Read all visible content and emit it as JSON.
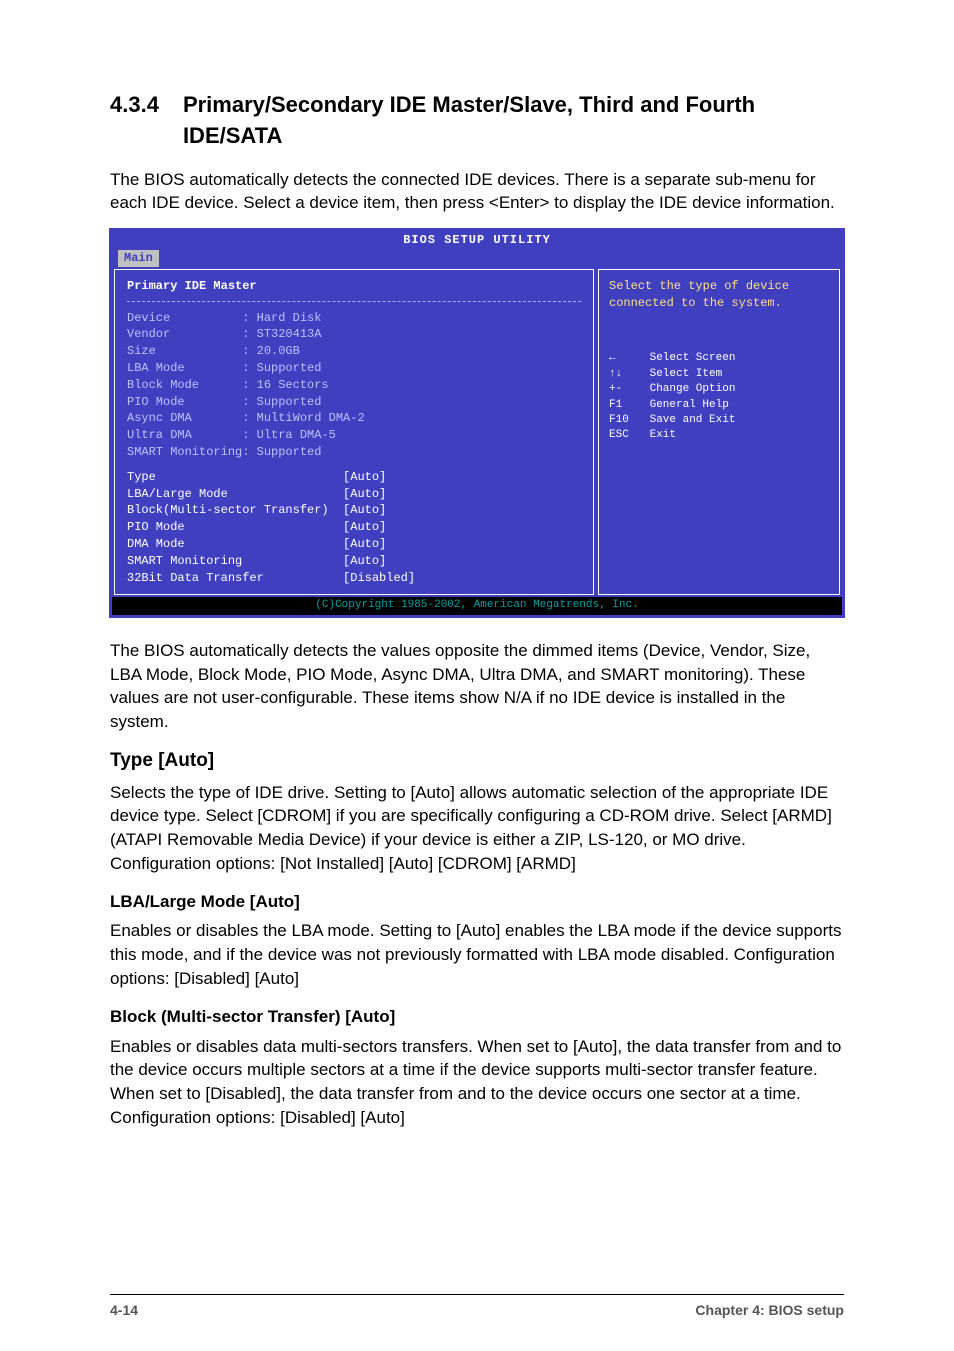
{
  "section": {
    "number": "4.3.4",
    "title": "Primary/Secondary IDE Master/Slave, Third and Fourth IDE/SATA"
  },
  "intro": "The BIOS automatically detects the connected IDE devices. There is a separate sub-menu for each IDE device. Select a device item, then press <Enter> to display the IDE device information.",
  "bios": {
    "title": "BIOS SETUP UTILITY",
    "tab": "Main",
    "left_header": "Primary IDE Master",
    "info": [
      {
        "label": "Device",
        "value": ": Hard Disk"
      },
      {
        "label": "Vendor",
        "value": ": ST320413A"
      },
      {
        "label": "Size",
        "value": ": 20.0GB"
      },
      {
        "label": "LBA Mode",
        "value": ": Supported"
      },
      {
        "label": "Block Mode",
        "value": ": 16 Sectors"
      },
      {
        "label": "PIO Mode",
        "value": ": Supported"
      },
      {
        "label": "Async DMA",
        "value": ": MultiWord DMA-2"
      },
      {
        "label": "Ultra DMA",
        "value": ": Ultra DMA-5"
      },
      {
        "label": "SMART Monitoring",
        "value": ": Supported"
      }
    ],
    "options": [
      {
        "label": "Type",
        "value": "[Auto]"
      },
      {
        "label": "LBA/Large Mode",
        "value": "[Auto]"
      },
      {
        "label": "Block(Multi-sector Transfer)",
        "value": "[Auto]"
      },
      {
        "label": "PIO Mode",
        "value": "[Auto]"
      },
      {
        "label": "DMA Mode",
        "value": "[Auto]"
      },
      {
        "label": "SMART Monitoring",
        "value": "[Auto]"
      },
      {
        "label": "32Bit Data Transfer",
        "value": "[Disabled]"
      }
    ],
    "help_text": "Select the type of device connected to the system.",
    "keys": [
      {
        "k": "←",
        "t": "Select Screen"
      },
      {
        "k": "↑↓",
        "t": "Select Item"
      },
      {
        "k": "+-",
        "t": "Change Option"
      },
      {
        "k": "F1",
        "t": "General Help"
      },
      {
        "k": "F10",
        "t": "Save and Exit"
      },
      {
        "k": "ESC",
        "t": "Exit"
      }
    ],
    "footer": "(C)Copyright 1985-2002, American Megatrends, Inc."
  },
  "after_bios": "The BIOS automatically detects the values opposite the dimmed items (Device, Vendor, Size, LBA Mode, Block Mode, PIO Mode, Async DMA, Ultra DMA, and SMART monitoring). These values are not user-configurable. These items show N/A if no IDE device is installed in the system.",
  "type": {
    "heading": "Type [Auto]",
    "body": "Selects the type of IDE drive. Setting to [Auto] allows automatic selection of the appropriate IDE device type. Select [CDROM] if you are specifically configuring a CD-ROM drive. Select [ARMD] (ATAPI Removable Media Device) if your device is either a ZIP, LS-120, or MO drive. Configuration options: [Not Installed] [Auto] [CDROM] [ARMD]"
  },
  "lba": {
    "heading": "LBA/Large Mode [Auto]",
    "body": "Enables or disables the LBA mode. Setting to [Auto] enables the LBA mode if the device supports this mode, and if the device was not previously formatted with LBA mode disabled. Configuration options: [Disabled] [Auto]"
  },
  "block": {
    "heading": "Block (Multi-sector Transfer) [Auto]",
    "body": "Enables or disables data multi-sectors transfers. When set to [Auto], the data transfer from and to the device occurs multiple sectors at a time if the device supports multi-sector transfer feature. When set to [Disabled], the data transfer from and to the device occurs one sector at a time. Configuration options: [Disabled] [Auto]"
  },
  "footer": {
    "left": "4-14",
    "right": "Chapter 4: BIOS setup"
  }
}
